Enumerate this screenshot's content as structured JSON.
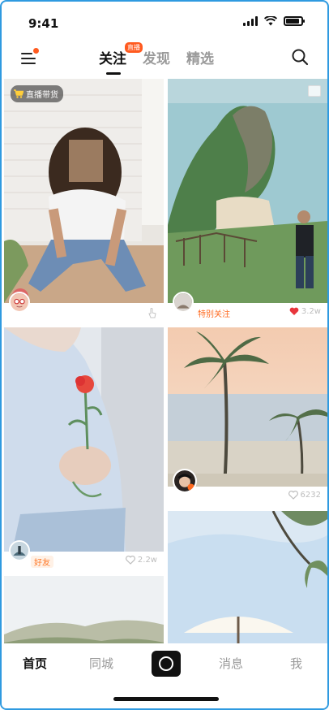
{
  "status_bar": {
    "time": "9:41"
  },
  "top_nav": {
    "tabs": [
      {
        "label": "关注",
        "badge": "直播",
        "active": true
      },
      {
        "label": "发现",
        "active": false
      },
      {
        "label": "精选",
        "active": false
      }
    ],
    "menu_icon": "hamburger-menu-icon",
    "search_icon": "search-icon"
  },
  "feed": {
    "cards": [
      {
        "id": "card-1",
        "badge": "直播带货",
        "likes": ""
      },
      {
        "id": "card-2",
        "tag": "特别关注",
        "likes": "3.2w",
        "liked": true
      },
      {
        "id": "card-3",
        "tag": "好友",
        "likes": "2.2w"
      },
      {
        "id": "card-4",
        "likes": "6232"
      }
    ]
  },
  "bottom_nav": {
    "items": [
      {
        "label": "首页",
        "active": true
      },
      {
        "label": "同城",
        "active": false
      },
      {
        "label": "消息",
        "active": false
      },
      {
        "label": "我",
        "active": false
      }
    ]
  },
  "colors": {
    "accent": "#ff5a1f",
    "liked": "#e8363c",
    "frame": "#2f9ae0"
  }
}
